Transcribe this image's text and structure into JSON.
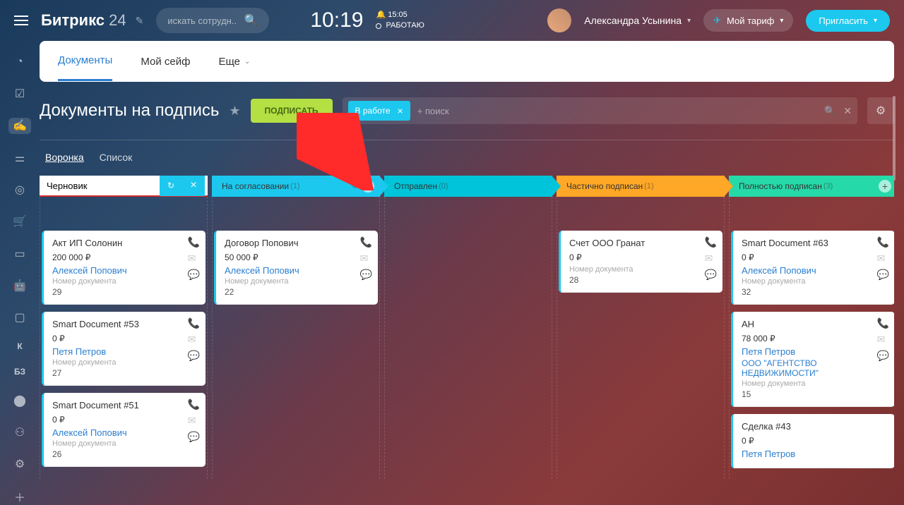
{
  "topbar": {
    "logo_main": "Битрикс",
    "logo_sub": "24",
    "search_placeholder": "искать сотрудн...",
    "clock": "10:19",
    "next_time": "15:05",
    "work_status": "РАБОТАЮ",
    "user_name": "Александра Усынина",
    "tariff_label": "Мой тариф",
    "invite_label": "Пригласить"
  },
  "tabs": {
    "documents": "Документы",
    "safe": "Мой сейф",
    "more": "Еще"
  },
  "page": {
    "title": "Документы на подпись",
    "sign_button": "ПОДПИСАТЬ",
    "filter_chip": "В работе",
    "filter_placeholder": "+ поиск"
  },
  "views": {
    "funnel": "Воронка",
    "list": "Список"
  },
  "columns": {
    "draft": {
      "name_input": "Черновик"
    },
    "approval": {
      "name": "На согласовании",
      "count": "(1)"
    },
    "sent": {
      "name": "Отправлен",
      "count": "(0)"
    },
    "partial": {
      "name": "Частично подписан",
      "count": "(1)"
    },
    "full": {
      "name": "Полностью подписан",
      "count": "(3)"
    }
  },
  "cards": {
    "c1": {
      "title": "Акт ИП Солонин",
      "price": "200 000 ₽",
      "person": "Алексей Попович",
      "label": "Номер документа",
      "num": "29"
    },
    "c2": {
      "title": "Smart Document #53",
      "price": "0 ₽",
      "person": "Петя Петров",
      "label": "Номер документа",
      "num": "27"
    },
    "c3": {
      "title": "Smart Document #51",
      "price": "0 ₽",
      "person": "Алексей Попович",
      "label": "Номер документа",
      "num": "26"
    },
    "c4": {
      "title": "Договор Попович",
      "price": "50 000 ₽",
      "person": "Алексей Попович",
      "label": "Номер документа",
      "num": "22"
    },
    "c5": {
      "title": "Счет ООО Гранат",
      "price": "0 ₽",
      "label": "Номер документа",
      "num": "28"
    },
    "c6": {
      "title": "Smart Document #63",
      "price": "0 ₽",
      "person": "Алексей Попович",
      "label": "Номер документа",
      "num": "32"
    },
    "c7": {
      "title": "АН",
      "price": "78 000 ₽",
      "person": "Петя Петров",
      "company": "ООО \"АГЕНТСТВО НЕДВИЖИМОСТИ\"",
      "label": "Номер документа",
      "num": "15"
    },
    "c8": {
      "title": "Сделка #43",
      "price": "0 ₽",
      "person": "Петя Петров"
    }
  }
}
